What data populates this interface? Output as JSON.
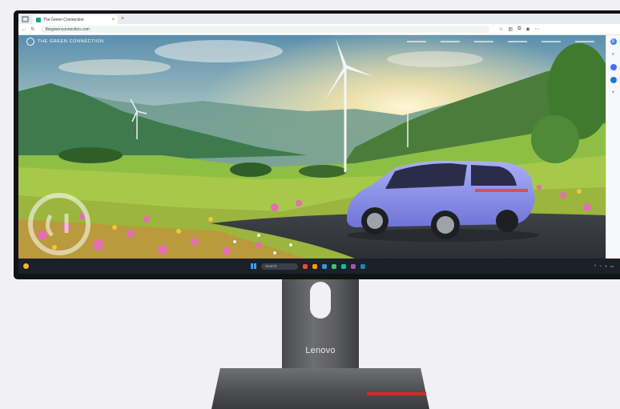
{
  "browser": {
    "tab_title": "The Green Connection",
    "tab_close": "×",
    "new_tab": "+",
    "url": "thegreenconnection.com"
  },
  "site": {
    "brand": "THE GREEN CONNECTION"
  },
  "taskbar": {
    "search_placeholder": "Search"
  },
  "monitor": {
    "brand": "Lenovo"
  },
  "colors": {
    "accent_red": "#d42a2a",
    "brand_green": "#14a58a",
    "taskbar_bg": "#1c2029",
    "car_body": "#8e93f0"
  }
}
